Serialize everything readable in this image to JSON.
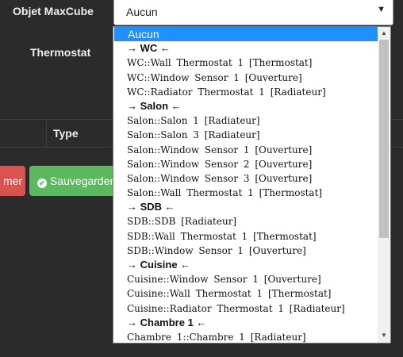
{
  "form": {
    "objet_label": "Objet MaxCube",
    "thermostat_label": "Thermostat",
    "table_type_header": "Type",
    "cancel_label": "mer",
    "save_label": "Sauvegarder"
  },
  "select": {
    "value": "Aucun",
    "options": [
      {
        "label": "Aucun",
        "kind": "selected"
      },
      {
        "label": "→ WC ←",
        "kind": "group"
      },
      {
        "label": "WC::Wall Thermostat 1 [Thermostat]",
        "kind": "item"
      },
      {
        "label": "WC::Window Sensor 1 [Ouverture]",
        "kind": "item"
      },
      {
        "label": "WC::Radiator Thermostat 1 [Radiateur]",
        "kind": "item"
      },
      {
        "label": "→ Salon ←",
        "kind": "group"
      },
      {
        "label": "Salon::Salon 1 [Radiateur]",
        "kind": "item"
      },
      {
        "label": "Salon::Salon 3 [Radiateur]",
        "kind": "item"
      },
      {
        "label": "Salon::Window Sensor 1 [Ouverture]",
        "kind": "item"
      },
      {
        "label": "Salon::Window Sensor 2 [Ouverture]",
        "kind": "item"
      },
      {
        "label": "Salon::Window Sensor 3 [Ouverture]",
        "kind": "item"
      },
      {
        "label": "Salon::Wall Thermostat 1 [Thermostat]",
        "kind": "item"
      },
      {
        "label": "→ SDB ←",
        "kind": "group"
      },
      {
        "label": "SDB::SDB [Radiateur]",
        "kind": "item"
      },
      {
        "label": "SDB::Wall Thermostat 1 [Thermostat]",
        "kind": "item"
      },
      {
        "label": "SDB::Window Sensor 1 [Ouverture]",
        "kind": "item"
      },
      {
        "label": "→ Cuisine ←",
        "kind": "group"
      },
      {
        "label": "Cuisine::Window Sensor 1 [Ouverture]",
        "kind": "item"
      },
      {
        "label": "Cuisine::Wall Thermostat 1 [Thermostat]",
        "kind": "item"
      },
      {
        "label": "Cuisine::Radiator Thermostat 1 [Radiateur]",
        "kind": "item"
      },
      {
        "label": "→ Chambre 1 ←",
        "kind": "group"
      },
      {
        "label": "Chambre 1::Chambre 1 [Radiateur]",
        "kind": "item"
      }
    ]
  },
  "colors": {
    "selected_option": "#1e90ff",
    "cancel_button": "#d9534f",
    "save_button": "#5cb85c"
  }
}
